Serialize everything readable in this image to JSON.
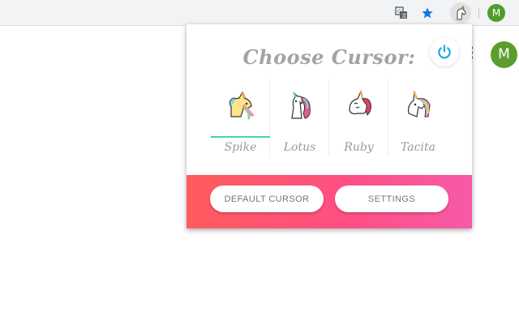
{
  "toolbar": {
    "icons": [
      "translate-icon",
      "star-icon",
      "unicorn-extension-icon"
    ],
    "avatar_letter": "M",
    "accent": "#1a73e8"
  },
  "page": {
    "avatar_letter": "M",
    "avatar_color": "#5b9e2f"
  },
  "popup": {
    "title": "Choose Cursor:",
    "power_icon": "power-icon",
    "power_color": "#1aa6e8",
    "cursors": [
      {
        "label": "Spike",
        "selected": true
      },
      {
        "label": "Lotus",
        "selected": false
      },
      {
        "label": "Ruby",
        "selected": false
      },
      {
        "label": "Tacita",
        "selected": false
      }
    ],
    "buttons": {
      "default_label": "DEFAULT CURSOR",
      "settings_label": "SETTINGS"
    },
    "gradient": [
      "#ff5c5c",
      "#f75aa8"
    ],
    "selected_color": "#4cd3a2"
  }
}
